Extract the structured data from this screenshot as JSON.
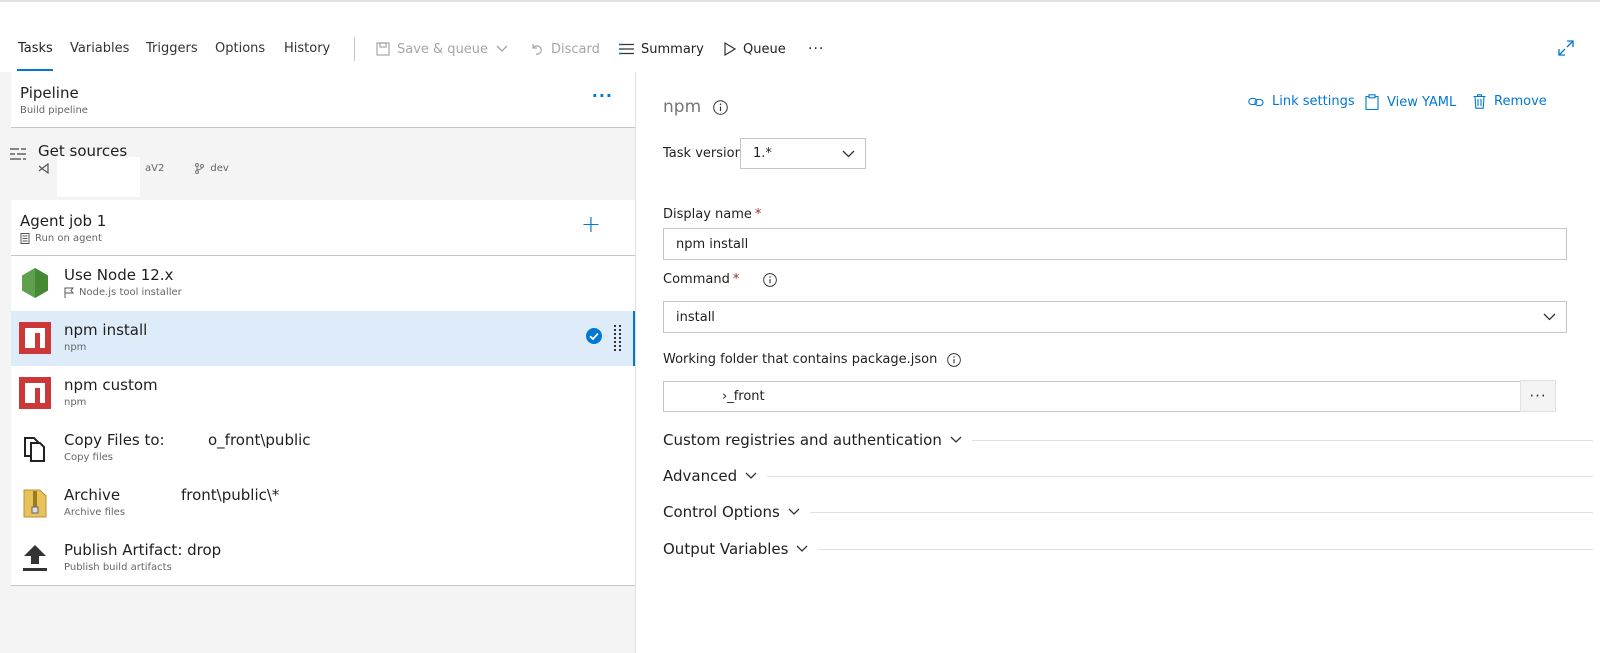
{
  "toolbar": {
    "tabs": [
      "Tasks",
      "Variables",
      "Triggers",
      "Options",
      "History"
    ],
    "save_queue": "Save & queue",
    "discard": "Discard",
    "summary": "Summary",
    "queue": "Queue",
    "more": "···"
  },
  "pipeline": {
    "title": "Pipeline",
    "subtitle": "Build pipeline",
    "more": "···"
  },
  "sources": {
    "title": "Get sources",
    "repo": "aV2",
    "branch": "dev"
  },
  "agent_job": {
    "title": "Agent job 1",
    "subtitle": "Run on agent",
    "add": "+"
  },
  "tasks": [
    {
      "title": "Use Node 12.x",
      "subtitle": "Node.js tool installer"
    },
    {
      "title": "npm install",
      "subtitle": "npm"
    },
    {
      "title": "npm custom",
      "subtitle": "npm"
    },
    {
      "title_a": "Copy Files to:",
      "title_b": "o_front\\public",
      "subtitle": "Copy files"
    },
    {
      "title_a": "Archive",
      "title_b": "front\\public\\*",
      "subtitle": "Archive files"
    },
    {
      "title": "Publish Artifact: drop",
      "subtitle": "Publish build artifacts"
    }
  ],
  "detail": {
    "title": "npm",
    "link_settings": "Link settings",
    "view_yaml": "View YAML",
    "remove": "Remove",
    "task_version_label": "Task version",
    "task_version": "1.*",
    "display_name_label": "Display name",
    "display_name": "npm install",
    "command_label": "Command",
    "command": "install",
    "working_folder_label": "Working folder that contains package.json",
    "working_folder": "›_front",
    "browse": "···",
    "sections": [
      "Custom registries and authentication",
      "Advanced",
      "Control Options",
      "Output Variables"
    ],
    "required_mark": "*"
  },
  "colors": {
    "accent": "#0078d4",
    "selected_bg": "#deecf9",
    "npm_red": "#cb3837",
    "node_green": "#5fa04e"
  }
}
